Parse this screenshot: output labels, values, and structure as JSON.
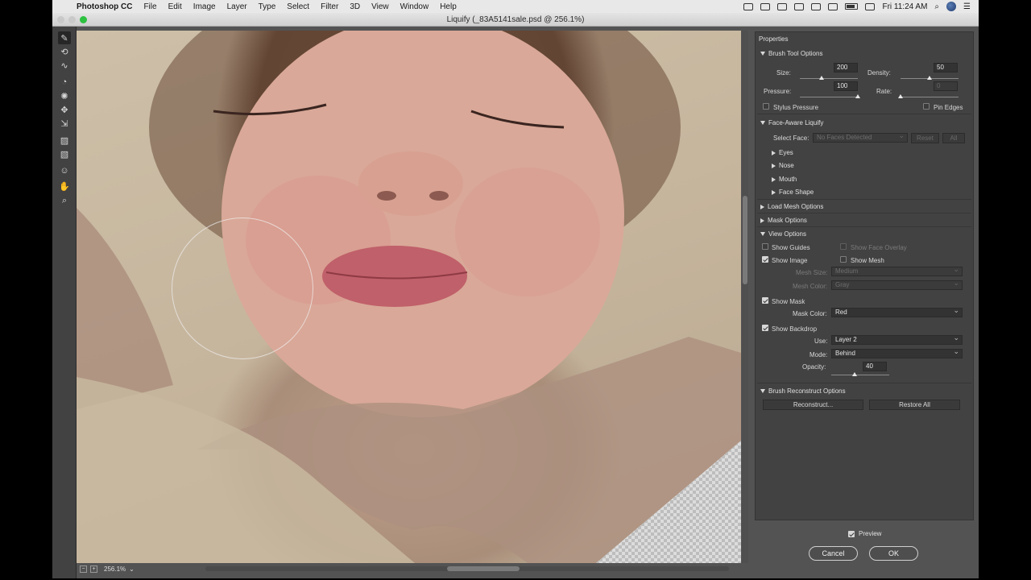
{
  "menubar": {
    "app_name": "Photoshop CC",
    "items": [
      "File",
      "Edit",
      "Image",
      "Layer",
      "Type",
      "Select",
      "Filter",
      "3D",
      "View",
      "Window",
      "Help"
    ],
    "clock": "Fri 11:24 AM"
  },
  "window": {
    "title": "Liquify (_83A5141sale.psd @ 256.1%)"
  },
  "statusbar": {
    "zoom": "256.1%",
    "zoom_out": "−",
    "zoom_in": "+"
  },
  "panel": {
    "title": "Properties",
    "brush_tool_options": {
      "header": "Brush Tool Options",
      "size_label": "Size:",
      "size_value": "200",
      "density_label": "Density:",
      "density_value": "50",
      "pressure_label": "Pressure:",
      "pressure_value": "100",
      "rate_label": "Rate:",
      "rate_value": "0",
      "stylus_label": "Stylus Pressure",
      "pin_edges_label": "Pin Edges"
    },
    "face_aware": {
      "header": "Face-Aware Liquify",
      "select_face_label": "Select Face:",
      "select_face_value": "No Faces Detected",
      "reset_label": "Reset",
      "all_label": "All",
      "groups": [
        "Eyes",
        "Nose",
        "Mouth",
        "Face Shape"
      ]
    },
    "load_mesh_header": "Load Mesh Options",
    "mask_options_header": "Mask Options",
    "view_options": {
      "header": "View Options",
      "show_guides": "Show Guides",
      "show_face_overlay": "Show Face Overlay",
      "show_image": "Show Image",
      "show_mesh": "Show Mesh",
      "mesh_size_label": "Mesh Size:",
      "mesh_size_value": "Medium",
      "mesh_color_label": "Mesh Color:",
      "mesh_color_value": "Gray",
      "show_mask": "Show Mask",
      "mask_color_label": "Mask Color:",
      "mask_color_value": "Red",
      "show_backdrop": "Show Backdrop",
      "use_label": "Use:",
      "use_value": "Layer 2",
      "mode_label": "Mode:",
      "mode_value": "Behind",
      "opacity_label": "Opacity:",
      "opacity_value": "40"
    },
    "reconstruct": {
      "header": "Brush Reconstruct Options",
      "reconstruct_label": "Reconstruct...",
      "restore_all_label": "Restore All"
    }
  },
  "dialog": {
    "preview_label": "Preview",
    "cancel_label": "Cancel",
    "ok_label": "OK"
  },
  "levels": {
    "size": 0.37,
    "density": 0.5,
    "pressure": 1.0,
    "rate": 0.0,
    "opacity": 0.4
  }
}
